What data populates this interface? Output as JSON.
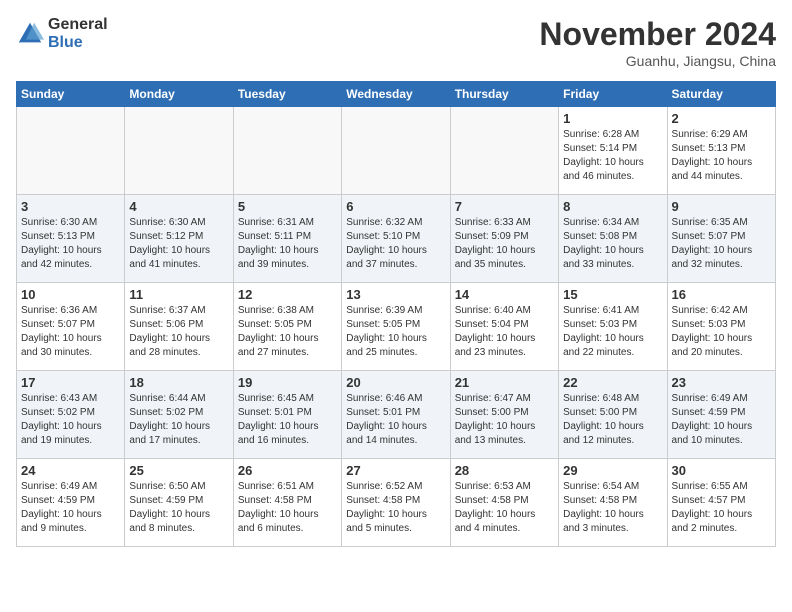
{
  "logo": {
    "general": "General",
    "blue": "Blue"
  },
  "header": {
    "month": "November 2024",
    "location": "Guanhu, Jiangsu, China"
  },
  "weekdays": [
    "Sunday",
    "Monday",
    "Tuesday",
    "Wednesday",
    "Thursday",
    "Friday",
    "Saturday"
  ],
  "weeks": [
    [
      {
        "day": "",
        "info": ""
      },
      {
        "day": "",
        "info": ""
      },
      {
        "day": "",
        "info": ""
      },
      {
        "day": "",
        "info": ""
      },
      {
        "day": "",
        "info": ""
      },
      {
        "day": "1",
        "info": "Sunrise: 6:28 AM\nSunset: 5:14 PM\nDaylight: 10 hours and 46 minutes."
      },
      {
        "day": "2",
        "info": "Sunrise: 6:29 AM\nSunset: 5:13 PM\nDaylight: 10 hours and 44 minutes."
      }
    ],
    [
      {
        "day": "3",
        "info": "Sunrise: 6:30 AM\nSunset: 5:13 PM\nDaylight: 10 hours and 42 minutes."
      },
      {
        "day": "4",
        "info": "Sunrise: 6:30 AM\nSunset: 5:12 PM\nDaylight: 10 hours and 41 minutes."
      },
      {
        "day": "5",
        "info": "Sunrise: 6:31 AM\nSunset: 5:11 PM\nDaylight: 10 hours and 39 minutes."
      },
      {
        "day": "6",
        "info": "Sunrise: 6:32 AM\nSunset: 5:10 PM\nDaylight: 10 hours and 37 minutes."
      },
      {
        "day": "7",
        "info": "Sunrise: 6:33 AM\nSunset: 5:09 PM\nDaylight: 10 hours and 35 minutes."
      },
      {
        "day": "8",
        "info": "Sunrise: 6:34 AM\nSunset: 5:08 PM\nDaylight: 10 hours and 33 minutes."
      },
      {
        "day": "9",
        "info": "Sunrise: 6:35 AM\nSunset: 5:07 PM\nDaylight: 10 hours and 32 minutes."
      }
    ],
    [
      {
        "day": "10",
        "info": "Sunrise: 6:36 AM\nSunset: 5:07 PM\nDaylight: 10 hours and 30 minutes."
      },
      {
        "day": "11",
        "info": "Sunrise: 6:37 AM\nSunset: 5:06 PM\nDaylight: 10 hours and 28 minutes."
      },
      {
        "day": "12",
        "info": "Sunrise: 6:38 AM\nSunset: 5:05 PM\nDaylight: 10 hours and 27 minutes."
      },
      {
        "day": "13",
        "info": "Sunrise: 6:39 AM\nSunset: 5:05 PM\nDaylight: 10 hours and 25 minutes."
      },
      {
        "day": "14",
        "info": "Sunrise: 6:40 AM\nSunset: 5:04 PM\nDaylight: 10 hours and 23 minutes."
      },
      {
        "day": "15",
        "info": "Sunrise: 6:41 AM\nSunset: 5:03 PM\nDaylight: 10 hours and 22 minutes."
      },
      {
        "day": "16",
        "info": "Sunrise: 6:42 AM\nSunset: 5:03 PM\nDaylight: 10 hours and 20 minutes."
      }
    ],
    [
      {
        "day": "17",
        "info": "Sunrise: 6:43 AM\nSunset: 5:02 PM\nDaylight: 10 hours and 19 minutes."
      },
      {
        "day": "18",
        "info": "Sunrise: 6:44 AM\nSunset: 5:02 PM\nDaylight: 10 hours and 17 minutes."
      },
      {
        "day": "19",
        "info": "Sunrise: 6:45 AM\nSunset: 5:01 PM\nDaylight: 10 hours and 16 minutes."
      },
      {
        "day": "20",
        "info": "Sunrise: 6:46 AM\nSunset: 5:01 PM\nDaylight: 10 hours and 14 minutes."
      },
      {
        "day": "21",
        "info": "Sunrise: 6:47 AM\nSunset: 5:00 PM\nDaylight: 10 hours and 13 minutes."
      },
      {
        "day": "22",
        "info": "Sunrise: 6:48 AM\nSunset: 5:00 PM\nDaylight: 10 hours and 12 minutes."
      },
      {
        "day": "23",
        "info": "Sunrise: 6:49 AM\nSunset: 4:59 PM\nDaylight: 10 hours and 10 minutes."
      }
    ],
    [
      {
        "day": "24",
        "info": "Sunrise: 6:49 AM\nSunset: 4:59 PM\nDaylight: 10 hours and 9 minutes."
      },
      {
        "day": "25",
        "info": "Sunrise: 6:50 AM\nSunset: 4:59 PM\nDaylight: 10 hours and 8 minutes."
      },
      {
        "day": "26",
        "info": "Sunrise: 6:51 AM\nSunset: 4:58 PM\nDaylight: 10 hours and 6 minutes."
      },
      {
        "day": "27",
        "info": "Sunrise: 6:52 AM\nSunset: 4:58 PM\nDaylight: 10 hours and 5 minutes."
      },
      {
        "day": "28",
        "info": "Sunrise: 6:53 AM\nSunset: 4:58 PM\nDaylight: 10 hours and 4 minutes."
      },
      {
        "day": "29",
        "info": "Sunrise: 6:54 AM\nSunset: 4:58 PM\nDaylight: 10 hours and 3 minutes."
      },
      {
        "day": "30",
        "info": "Sunrise: 6:55 AM\nSunset: 4:57 PM\nDaylight: 10 hours and 2 minutes."
      }
    ]
  ]
}
